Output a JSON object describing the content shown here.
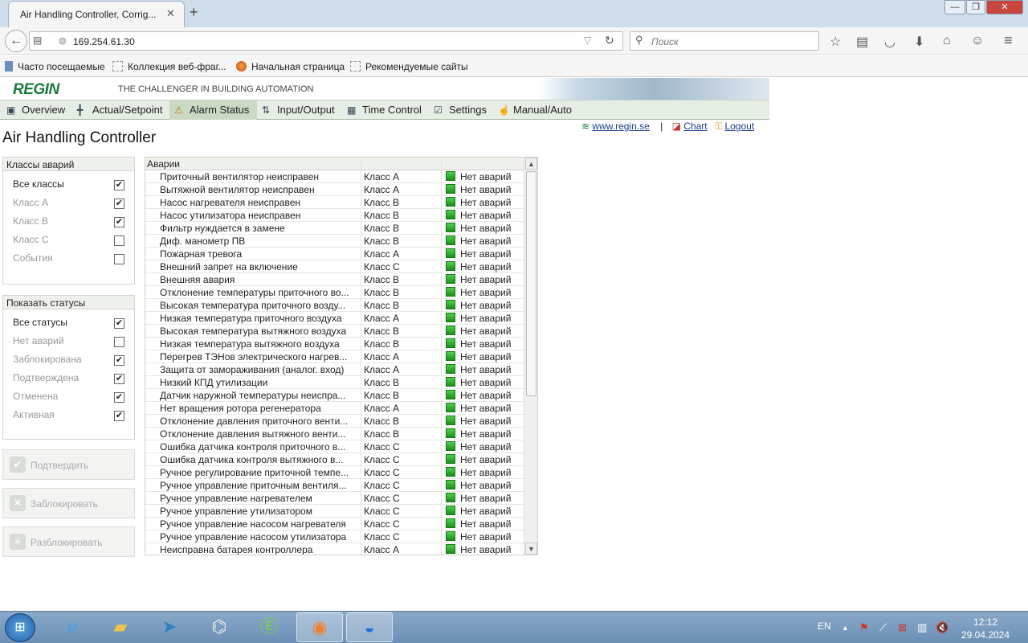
{
  "browser": {
    "tab_title": "Air Handling Controller, Corrig...",
    "tab_close": "✕",
    "new_tab": "+",
    "url": "169.254.61.30",
    "search_placeholder": "Поиск",
    "window_buttons": [
      "—",
      "❐",
      "✕"
    ],
    "bookmarks": [
      "Часто посещаемые",
      "Коллекция веб-фраг...",
      "Начальная страница",
      "Рекомендуемые сайты"
    ]
  },
  "app": {
    "logo": "REGIN",
    "tagline": "THE CHALLENGER IN BUILDING AUTOMATION",
    "menu": [
      "Overview",
      "Actual/Setpoint",
      "Alarm Status",
      "Input/Output",
      "Time Control",
      "Settings",
      "Manual/Auto"
    ],
    "page_title": "Air Handling Controller",
    "links": {
      "site": "www.regin.se",
      "separator": "|",
      "chart": "Chart",
      "logout": "Logout"
    },
    "accent_color": "#1a7a3c"
  },
  "filters": {
    "classes_title": "Классы аварий",
    "classes": [
      {
        "label": "Все классы",
        "checked": true
      },
      {
        "label": "Класс A",
        "checked": true
      },
      {
        "label": "Класс B",
        "checked": true
      },
      {
        "label": "Класс C",
        "checked": false
      },
      {
        "label": "События",
        "checked": false
      }
    ],
    "statuses_title": "Показать статусы",
    "statuses": [
      {
        "label": "Все статусы",
        "checked": true
      },
      {
        "label": "Нет аварий",
        "checked": false
      },
      {
        "label": "Заблокирована",
        "checked": true
      },
      {
        "label": "Подтверждена",
        "checked": true
      },
      {
        "label": "Отменена",
        "checked": true
      },
      {
        "label": "Активная",
        "checked": true
      }
    ]
  },
  "actions": [
    "Подтвердить",
    "Заблокировать",
    "Разблокировать"
  ],
  "alarms": {
    "header": "Аварии",
    "rows": [
      [
        "Приточный вентилятор неисправен",
        "Класс A",
        "Нет аварий"
      ],
      [
        "Вытяжной вентилятор неисправен",
        "Класс A",
        "Нет аварий"
      ],
      [
        "Насос нагревателя неисправен",
        "Класс B",
        "Нет аварий"
      ],
      [
        "Насос утилизатора неисправен",
        "Класс B",
        "Нет аварий"
      ],
      [
        "Фильтр нуждается в замене",
        "Класс B",
        "Нет аварий"
      ],
      [
        "Диф. манометр ПВ",
        "Класс B",
        "Нет аварий"
      ],
      [
        "Пожарная тревога",
        "Класс A",
        "Нет аварий"
      ],
      [
        "Внешний запрет на включение",
        "Класс C",
        "Нет аварий"
      ],
      [
        "Внешняя авария",
        "Класс B",
        "Нет аварий"
      ],
      [
        "Отклонение температуры приточного во...",
        "Класс B",
        "Нет аварий"
      ],
      [
        "Высокая температура приточного возду...",
        "Класс B",
        "Нет аварий"
      ],
      [
        "Низкая температура приточного воздуха",
        "Класс A",
        "Нет аварий"
      ],
      [
        "Высокая температура вытяжного воздуха",
        "Класс B",
        "Нет аварий"
      ],
      [
        "Низкая температура вытяжного воздуха",
        "Класс B",
        "Нет аварий"
      ],
      [
        "Перегрев ТЭНов электрического нагрев...",
        "Класс A",
        "Нет аварий"
      ],
      [
        "Защита от замораживания (аналог. вход)",
        "Класс A",
        "Нет аварий"
      ],
      [
        "Низкий КПД утилизации",
        "Класс B",
        "Нет аварий"
      ],
      [
        "Датчик наружной температуры неиспра...",
        "Класс B",
        "Нет аварий"
      ],
      [
        "Нет вращения ротора регенератора",
        "Класс A",
        "Нет аварий"
      ],
      [
        "Отклонение давления приточного венти...",
        "Класс B",
        "Нет аварий"
      ],
      [
        "Отклонение давления вытяжного венти...",
        "Класс B",
        "Нет аварий"
      ],
      [
        "Ошибка датчика контроля приточного в...",
        "Класс C",
        "Нет аварий"
      ],
      [
        "Ошибка датчика контроля вытяжного в...",
        "Класс C",
        "Нет аварий"
      ],
      [
        "Ручное регулирование приточной темпе...",
        "Класс C",
        "Нет аварий"
      ],
      [
        "Ручное управление приточным вентиля...",
        "Класс C",
        "Нет аварий"
      ],
      [
        "Ручное управление нагревателем",
        "Класс C",
        "Нет аварий"
      ],
      [
        "Ручное управление утилизатором",
        "Класс C",
        "Нет аварий"
      ],
      [
        "Ручное управление насосом нагревателя",
        "Класс C",
        "Нет аварий"
      ],
      [
        "Ручное управление насосом утилизатора",
        "Класс C",
        "Нет аварий"
      ],
      [
        "Неисправна батарея контроллера",
        "Класс A",
        "Нет аварий"
      ]
    ]
  },
  "taskbar": {
    "language": "EN",
    "time": "12:12",
    "date": "29.04.2024"
  }
}
